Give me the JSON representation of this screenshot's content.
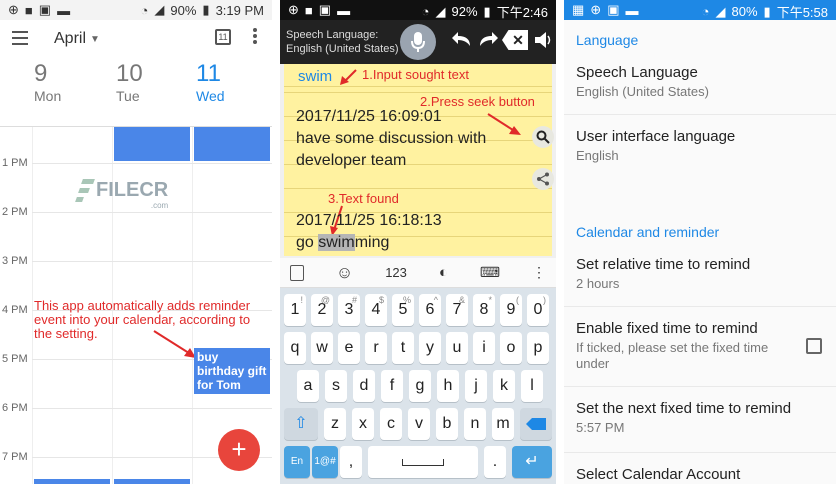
{
  "calendar": {
    "status_time": "3:19 PM",
    "battery": "90%",
    "month": "April",
    "days": [
      {
        "num": "9",
        "name": "Mon"
      },
      {
        "num": "10",
        "name": "Tue"
      },
      {
        "num": "11",
        "name": "Wed"
      }
    ],
    "hours": [
      "1 PM",
      "2 PM",
      "3 PM",
      "4 PM",
      "5 PM",
      "6 PM",
      "7 PM"
    ],
    "event_text": "buy birthday gift for Tom",
    "annotation": "This app automatically adds reminder event into your calendar, according to the setting.",
    "watermark": "FILECR",
    "watermark_sub": ".com",
    "fab_label": "+"
  },
  "notes": {
    "status_time": "下午2:46",
    "battery": "92%",
    "speech_label": "Speech Language:",
    "speech_value": "English (United States)",
    "search_text": "swim",
    "step1": "1.Input sought text",
    "step2": "2.Press seek button",
    "step3": "3.Text found",
    "entry1_time": "2017/11/25 16:09:01",
    "entry1_text1": "have some discussion with",
    "entry1_text2": "developer team",
    "entry2_time": "2017/11/25 16:18:13",
    "entry2_pre": "go ",
    "entry2_hl": "swim",
    "entry2_post": "ming",
    "kb_tool_123": "123",
    "keys": {
      "row1": [
        "1",
        "2",
        "3",
        "4",
        "5",
        "6",
        "7",
        "8",
        "9",
        "0"
      ],
      "row1_sub": [
        "!",
        "@",
        "#",
        "$",
        "%",
        "^",
        "&",
        "*",
        "(",
        ")"
      ],
      "row2": [
        "q",
        "w",
        "e",
        "r",
        "t",
        "y",
        "u",
        "i",
        "o",
        "p"
      ],
      "row3": [
        "a",
        "s",
        "d",
        "f",
        "g",
        "h",
        "j",
        "k",
        "l"
      ],
      "row4": [
        "z",
        "x",
        "c",
        "v",
        "b",
        "n",
        "m"
      ],
      "lang": "En",
      "sym": "1@#",
      "comma": ",",
      "period": "."
    }
  },
  "settings": {
    "status_time": "下午5:58",
    "battery": "80%",
    "section_language": "Language",
    "speech_language_title": "Speech Language",
    "speech_language_value": "English (United States)",
    "ui_language_title": "User interface language",
    "ui_language_value": "English",
    "section_calendar": "Calendar and reminder",
    "relative_title": "Set relative time to remind",
    "relative_value": "2 hours",
    "fixed_title": "Enable fixed time to remind",
    "fixed_desc": "If ticked, please set the fixed time under",
    "next_fixed_title": "Set the next fixed time to remind",
    "next_fixed_value": "5:57 PM",
    "calendar_account_title": "Select Calendar Account"
  },
  "colors": {
    "event_blue": "#4a86e8",
    "fab_red": "#e8453c",
    "accent_blue": "#1e88e5",
    "note_yellow": "#fff2a0",
    "annotation_red": "#e02a2a"
  }
}
